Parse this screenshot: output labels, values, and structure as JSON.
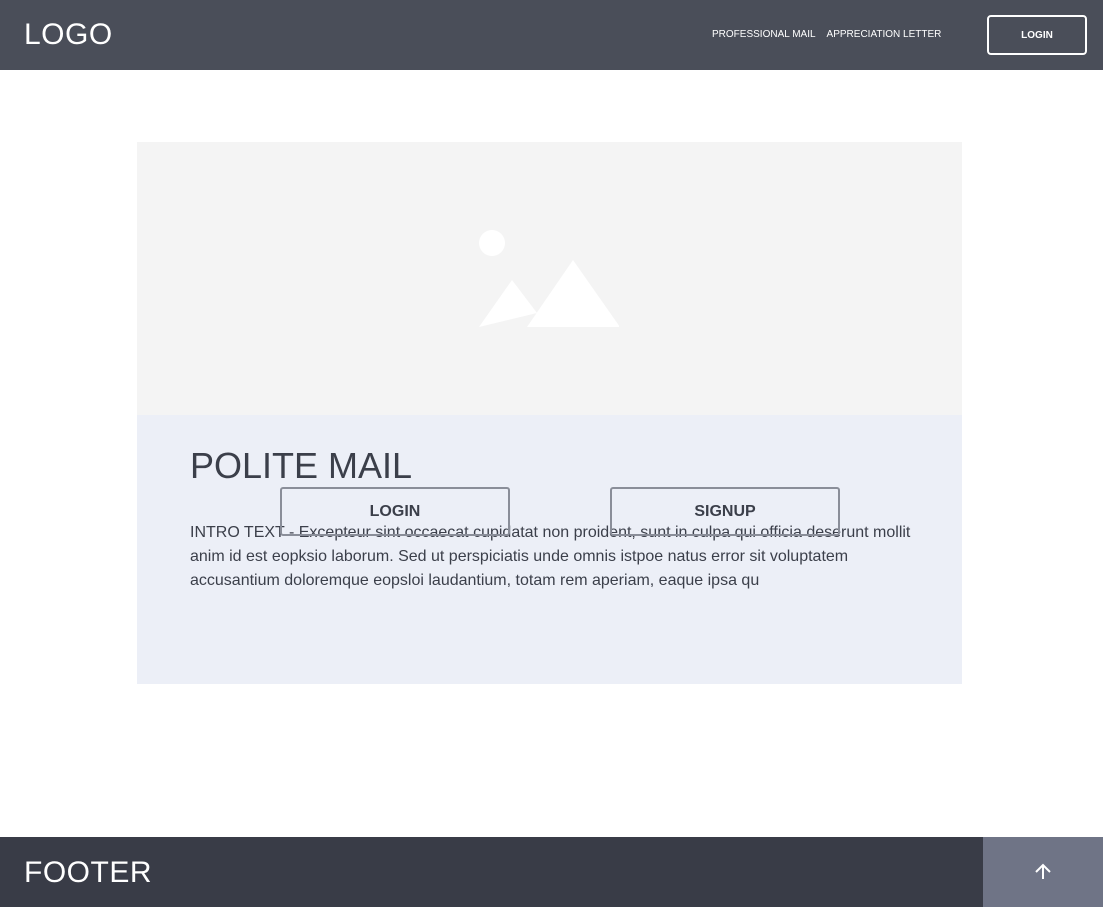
{
  "header": {
    "logo": "LOGO",
    "nav": [
      {
        "label": "PROFESSIONAL MAIL"
      },
      {
        "label": "APPRECIATION LETTER"
      }
    ],
    "login_label": "LOGIN"
  },
  "hero": {
    "image_icon": "image-placeholder-icon"
  },
  "card": {
    "title": "POLITE MAIL",
    "intro": "INTRO TEXT - Excepteur sint occaecat cupidatat non proident, sunt in culpa qui officia deserunt mollit anim id est eopksio laborum. Sed ut perspiciatis unde omnis istpoe natus error sit voluptatem accusantium doloremque eopsloi laudantium, totam rem aperiam, eaque ipsa qu",
    "login_label": "LOGIN",
    "signup_label": "SIGNUP"
  },
  "footer": {
    "text": "FOOTER",
    "back_to_top_icon": "arrow-up-icon"
  },
  "colors": {
    "header_bg": "#4a4e59",
    "footer_bg": "#393c47",
    "back_to_top_bg": "#6f7486",
    "hero_bg": "#f4f4f4",
    "card_body_bg": "#eceff7",
    "text_dark": "#3b3f4a"
  }
}
